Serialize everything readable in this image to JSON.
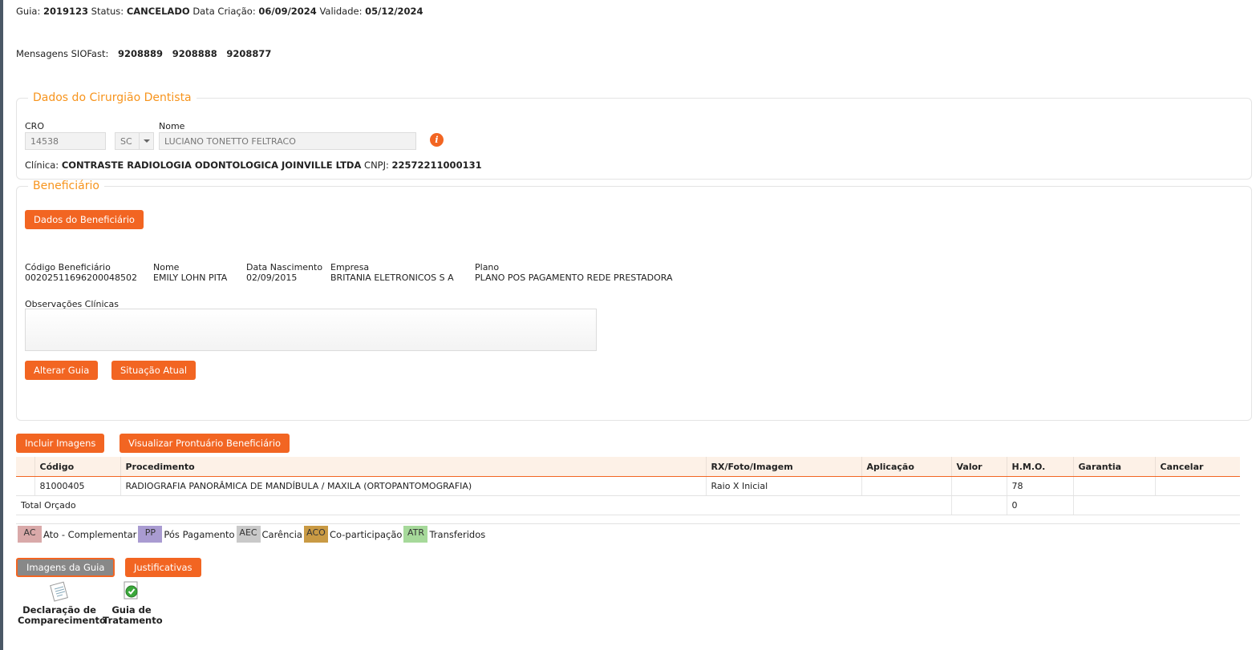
{
  "header": {
    "guia_label": "Guia:",
    "guia": "2019123",
    "status_label": "Status:",
    "status": "CANCELADO",
    "criacao_label": "Data Criação:",
    "criacao": "06/09/2024",
    "validade_label": "Validade:",
    "validade": "05/12/2024"
  },
  "mensagens": {
    "label": "Mensagens SIOFast:",
    "items": [
      "9208889",
      "9208888",
      "9208877"
    ]
  },
  "dentista": {
    "legend": "Dados do Cirurgião Dentista",
    "cro_label": "CRO",
    "cro": "14538",
    "uf": "SC",
    "nome_label": "Nome",
    "nome": "LUCIANO TONETTO FELTRACO",
    "info_icon": "i",
    "clinica_label": "Clínica:",
    "clinica": "CONTRASTE RADIOLOGIA ODONTOLOGICA JOINVILLE LTDA",
    "cnpj_label": "CNPJ:",
    "cnpj": "22572211000131"
  },
  "beneficiario": {
    "legend": "Beneficiário",
    "dados_button": "Dados do Beneficiário",
    "codigo_label": "Código Beneficiário",
    "codigo": "0020251169620004850​2",
    "nome_label": "Nome",
    "nome": "EMILY LOHN PITA",
    "nasc_label": "Data Nascimento",
    "nasc": "02/09/2015",
    "empresa_label": "Empresa",
    "empresa": "BRITANIA ELETRONICOS S A",
    "plano_label": "Plano",
    "plano": "PLANO POS PAGAMENTO REDE PRESTADORA",
    "obs_label": "Observações Clínicas",
    "alterar_button": "Alterar Guia",
    "situacao_button": "Situação Atual"
  },
  "actions": {
    "incluir": "Incluir Imagens",
    "visualizar": "Visualizar Prontuário Beneficiário"
  },
  "table": {
    "headers": [
      "Código",
      "Procedimento",
      "RX/Foto/Imagem",
      "Aplicação",
      "Valor",
      "H.M.O.",
      "Garantia",
      "Cancelar"
    ],
    "row": {
      "codigo": "81000405",
      "procedimento": "RADIOGRAFIA PANORÂMICA DE MANDÍBULA / MAXILA (ORTOPANTOMOGRAFIA)",
      "rx": "Raio X Inicial",
      "aplicacao": "",
      "valor": "",
      "hmo": "78",
      "garantia": "",
      "cancelar": ""
    },
    "total_label": "Total Orçado",
    "total_hmo": "0"
  },
  "legend": [
    {
      "code": "AC",
      "label": "Ato - Complementar",
      "color": "#d9a9a9"
    },
    {
      "code": "PP",
      "label": "Pós Pagamento",
      "color": "#a99bd1"
    },
    {
      "code": "AEC",
      "label": "Carência",
      "color": "#c9c9c9"
    },
    {
      "code": "ACO",
      "label": "Co-participação",
      "color": "#c99a44"
    },
    {
      "code": "ATR",
      "label": "Transferidos",
      "color": "#a6d99a"
    }
  ],
  "bottom": {
    "imagens_button": "Imagens da Guia",
    "justificativas_button": "Justificativas",
    "declaracao_l1": "Declaração de",
    "declaracao_l2": "Comparecimento",
    "guia_l1": "Guia de",
    "guia_l2": "Tratamento"
  }
}
